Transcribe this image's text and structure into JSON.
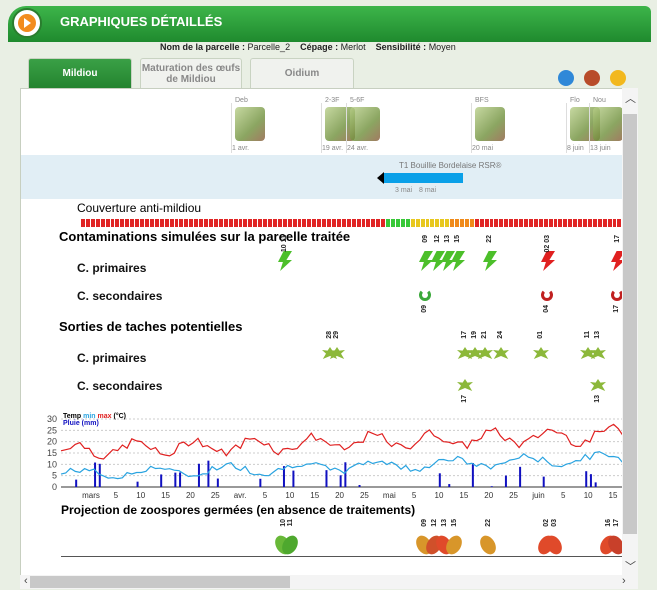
{
  "app": {
    "title": "GRAPHIQUES DÉTAILLÉS"
  },
  "parcel": {
    "name_label": "Nom de la parcelle :",
    "name": "Parcelle_2",
    "cepage_label": "Cépage :",
    "cepage": "Merlot",
    "sens_label": "Sensibilité :",
    "sens": "Moyen"
  },
  "tabs": [
    "Mildiou",
    "Maturation des œufs de Mildiou",
    "Oidium"
  ],
  "stages": [
    {
      "code": "Deb",
      "date": "1 avr."
    },
    {
      "code": "2-3F",
      "date": "19 avr."
    },
    {
      "code": "5-6F",
      "date": "24 avr."
    },
    {
      "code": "BFS",
      "date": "20 mai"
    },
    {
      "code": "Flo",
      "date": "8 juin"
    },
    {
      "code": "Nou",
      "date": "13 juin"
    }
  ],
  "treatment": {
    "label": "T1  Bouillie Bordelaise RSR®",
    "d1": "3 mai",
    "d2": "8 mai"
  },
  "sections": {
    "couverture": "Couverture anti-mildiou",
    "contaminations": "Contaminations simulées sur la parcelle traitée",
    "sorties": "Sorties de taches potentielles",
    "cprim": "C. primaires",
    "csec": "C. secondaires",
    "projection": "Projection de zoospores germées (en absence de traitements)"
  },
  "contam_primaires": [
    {
      "day": "10",
      "alt": "11",
      "color": "green"
    },
    {
      "day": "09",
      "alt": "",
      "color": "green"
    },
    {
      "day": "12",
      "alt": "",
      "color": "green"
    },
    {
      "day": "13",
      "alt": "",
      "color": "green"
    },
    {
      "day": "15",
      "alt": "",
      "color": "green"
    },
    {
      "day": "22",
      "alt": "",
      "color": "green"
    },
    {
      "day": "02",
      "alt": "03",
      "color": "red"
    },
    {
      "day": "17",
      "alt": "",
      "color": "red"
    }
  ],
  "contam_secondaires": [
    {
      "day": "09",
      "color": "green"
    },
    {
      "day": "04",
      "color": "red"
    },
    {
      "day": "17",
      "color": "red"
    }
  ],
  "sorties_primaires": [
    "28",
    "29",
    "17",
    "19",
    "21",
    "24",
    "01",
    "11",
    "13"
  ],
  "sorties_secondaires": [
    "17",
    "13"
  ],
  "meteo": {
    "legend_temp": "Temp",
    "legend_min": "min",
    "legend_max": "max",
    "legend_unit": "(°C)",
    "legend_rain": "Pluie (mm)",
    "yticks": [
      "30",
      "25",
      "20",
      "15",
      "10",
      "5",
      "0"
    ],
    "xticks": [
      "mars",
      "5",
      "10",
      "15",
      "20",
      "25",
      "avr.",
      "5",
      "10",
      "15",
      "20",
      "25",
      "mai",
      "5",
      "10",
      "15",
      "20",
      "25",
      "juin",
      "5",
      "10",
      "15"
    ],
    "colors": {
      "max": "#e02020",
      "min": "#29a3e0",
      "rain": "#1010c0"
    }
  },
  "projection_days": [
    "10",
    "11",
    "09",
    "12",
    "13",
    "15",
    "22",
    "02",
    "03",
    "16",
    "17"
  ]
}
